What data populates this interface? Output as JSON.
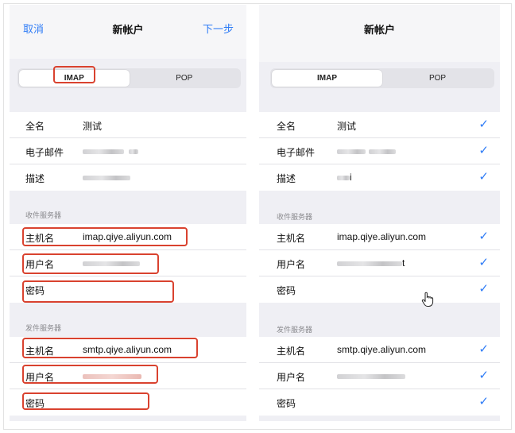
{
  "left": {
    "nav": {
      "cancel": "取消",
      "title": "新帐户",
      "next": "下一步"
    },
    "segment": {
      "imap": "IMAP",
      "pop": "POP",
      "selected": "IMAP"
    },
    "account": [
      {
        "label": "全名",
        "value": "测试"
      },
      {
        "label": "电子邮件",
        "value": ""
      },
      {
        "label": "描述",
        "value": ""
      }
    ],
    "incoming_header": "收件服务器",
    "incoming": [
      {
        "label": "主机名",
        "value": "imap.qiye.aliyun.com"
      },
      {
        "label": "用户名",
        "value": ""
      },
      {
        "label": "密码",
        "value": ""
      }
    ],
    "outgoing_header": "发件服务器",
    "outgoing": [
      {
        "label": "主机名",
        "value": "smtp.qiye.aliyun.com"
      },
      {
        "label": "用户名",
        "value": ""
      },
      {
        "label": "密码",
        "value": ""
      }
    ]
  },
  "right": {
    "nav": {
      "title": "新帐户"
    },
    "segment": {
      "imap": "IMAP",
      "pop": "POP",
      "selected": "IMAP"
    },
    "account": [
      {
        "label": "全名",
        "value": "测试"
      },
      {
        "label": "电子邮件",
        "value": ""
      },
      {
        "label": "描述",
        "value": "i"
      }
    ],
    "incoming_header": "收件服务器",
    "incoming": [
      {
        "label": "主机名",
        "value": "imap.qiye.aliyun.com"
      },
      {
        "label": "用户名",
        "value": "t"
      },
      {
        "label": "密码",
        "value": ""
      }
    ],
    "outgoing_header": "发件服务器",
    "outgoing": [
      {
        "label": "主机名",
        "value": "smtp.qiye.aliyun.com"
      },
      {
        "label": "用户名",
        "value": ""
      },
      {
        "label": "密码",
        "value": ""
      }
    ],
    "check_icon": "checkmark-icon"
  },
  "colors": {
    "accent": "#2f7cf6",
    "highlight": "#d9422f",
    "background": "#efeff4"
  }
}
